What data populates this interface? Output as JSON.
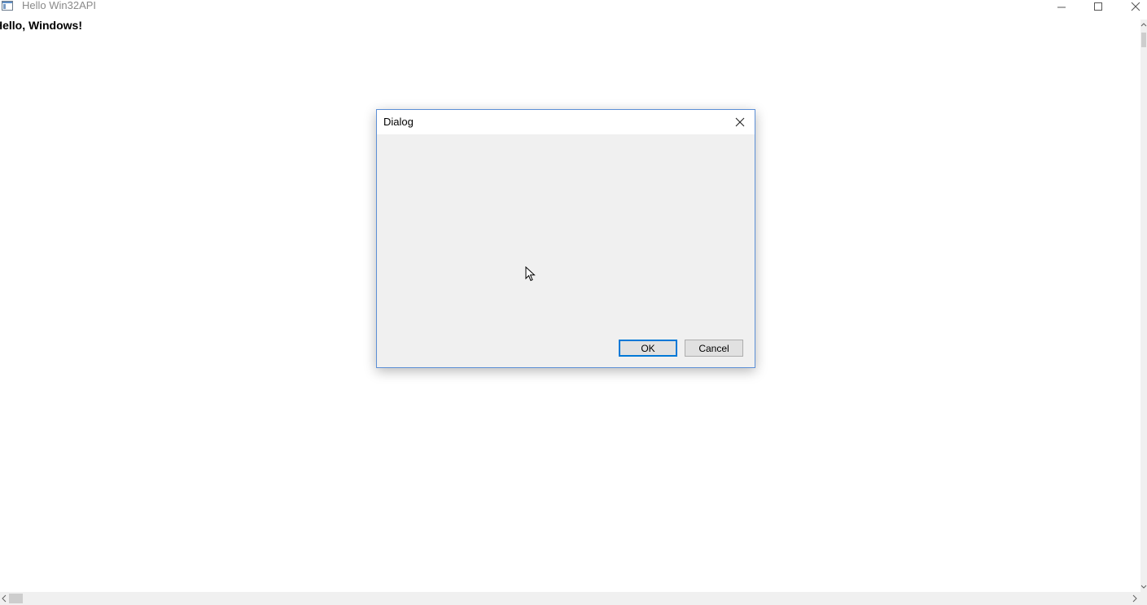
{
  "window": {
    "title": "Hello Win32API"
  },
  "client": {
    "text": "Hello, Windows!"
  },
  "dialog": {
    "title": "Dialog",
    "ok_label": "OK",
    "cancel_label": "Cancel"
  },
  "icons": {
    "app": "app-window-icon",
    "minimize": "minimize-icon",
    "maximize": "maximize-icon",
    "close": "close-icon",
    "dialog_close": "close-icon",
    "cursor": "mouse-pointer-icon"
  },
  "colors": {
    "dialog_border": "#5c8fd6",
    "dialog_body": "#f0f0f0",
    "default_button_border": "#0078d7",
    "title_text": "#8a8a8a"
  }
}
